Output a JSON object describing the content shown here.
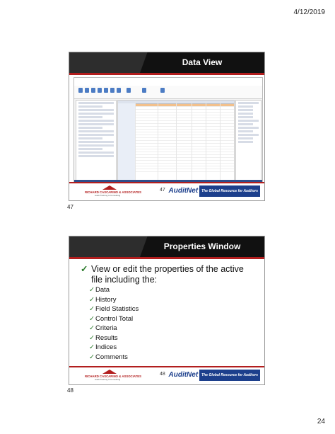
{
  "header": {
    "date": "4/12/2019"
  },
  "page": {
    "number": "24"
  },
  "slide1": {
    "title": "Data View",
    "slide_number": "47",
    "page_label": "47"
  },
  "slide2": {
    "title": "Properties Window",
    "slide_number": "48",
    "page_label": "48",
    "main_bullet": "View or edit the properties of the active file including the:",
    "sub_bullets": [
      "Data",
      "History",
      "Field Statistics",
      "Control Total",
      "Criteria",
      "Results",
      "Indices",
      "Comments"
    ]
  },
  "footer": {
    "firm_name": "RICHARD CASCARINO & ASSOCIATES",
    "firm_sub": "Audit Training & Consulting",
    "brand": "AuditNet",
    "brand_tag": "The Global Resource for Auditors"
  },
  "icons": {
    "check": "check-icon"
  },
  "colors": {
    "accent": "#b21e1e",
    "brand_blue": "#1c3f8c",
    "check_green": "#2a7a2a"
  }
}
